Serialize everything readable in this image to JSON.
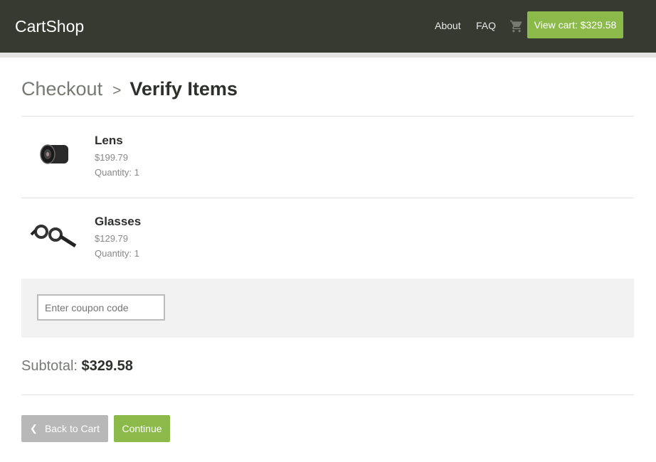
{
  "header": {
    "brand": "CartShop",
    "nav": [
      "About",
      "FAQ"
    ],
    "view_cart": "View cart: $329.58"
  },
  "breadcrumb": {
    "parent": "Checkout",
    "separator": ">",
    "current": "Verify Items"
  },
  "items": [
    {
      "name": "Lens",
      "price": "$199.79",
      "quantity": "Quantity: 1"
    },
    {
      "name": "Glasses",
      "price": "$129.79",
      "quantity": "Quantity: 1"
    }
  ],
  "coupon": {
    "placeholder": "Enter coupon code"
  },
  "subtotal": {
    "label": "Subtotal:",
    "value": "$329.58"
  },
  "buttons": {
    "back": "Back to Cart",
    "continue": "Continue"
  }
}
